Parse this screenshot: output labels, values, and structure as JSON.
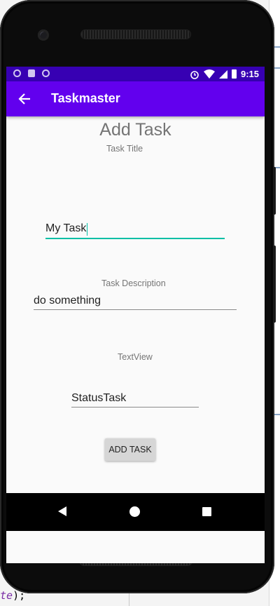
{
  "status_bar": {
    "time": "9:15",
    "left_icons": [
      "location-icon",
      "lock-icon",
      "sync-icon"
    ],
    "right_icons": [
      "alarm-icon",
      "wifi-icon",
      "signal-icon",
      "battery-icon"
    ]
  },
  "app_bar": {
    "title": "Taskmaster",
    "back_icon": "arrow-back-icon",
    "background_color": "#6200ee",
    "status_color": "#3700b3"
  },
  "form": {
    "heading": "Add Task",
    "title_label": "Task Title",
    "title_value": "My Task",
    "description_label": "Task Description",
    "description_value": "do something",
    "status_label": "TextView",
    "status_value": "StatusTask",
    "submit_label": "ADD TASK",
    "focus_color": "#00bfa5"
  },
  "nav_bar": {
    "icons": [
      "nav-back-icon",
      "nav-home-icon",
      "nav-recents-icon"
    ]
  },
  "ide": {
    "code_keyword": "te",
    "code_suffix": ");"
  }
}
